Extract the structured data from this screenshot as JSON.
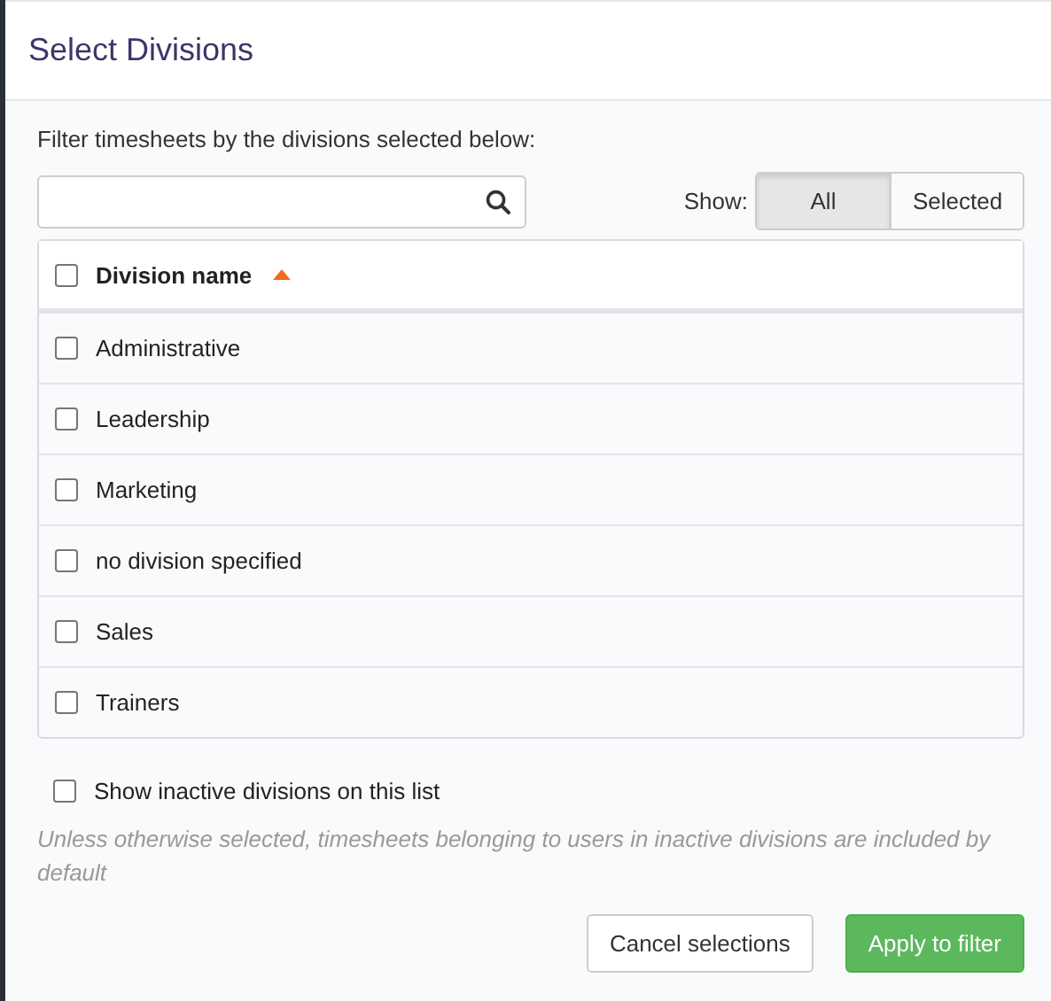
{
  "dialog": {
    "title": "Select Divisions"
  },
  "instructions": "Filter timesheets by the divisions selected below:",
  "show_filter": {
    "label": "Show:",
    "options": [
      {
        "label": "All",
        "selected": true
      },
      {
        "label": "Selected",
        "selected": false
      }
    ]
  },
  "table": {
    "header": {
      "label": "Division name",
      "checked": false,
      "sort_ascending": true
    },
    "rows": [
      {
        "name": "Administrative",
        "checked": false
      },
      {
        "name": "Leadership",
        "checked": false
      },
      {
        "name": "Marketing",
        "checked": false
      },
      {
        "name": "no division specified",
        "checked": false
      },
      {
        "name": "Sales",
        "checked": false
      },
      {
        "name": "Trainers",
        "checked": false
      }
    ]
  },
  "inactive_option": {
    "label": "Show inactive divisions on this list",
    "checked": false
  },
  "note": "Unless otherwise selected, timesheets belonging to users in inactive divisions are included by default",
  "buttons": [
    {
      "label": "Cancel selections",
      "kind": "secondary"
    },
    {
      "label": "Apply to filter",
      "kind": "primary"
    }
  ]
}
